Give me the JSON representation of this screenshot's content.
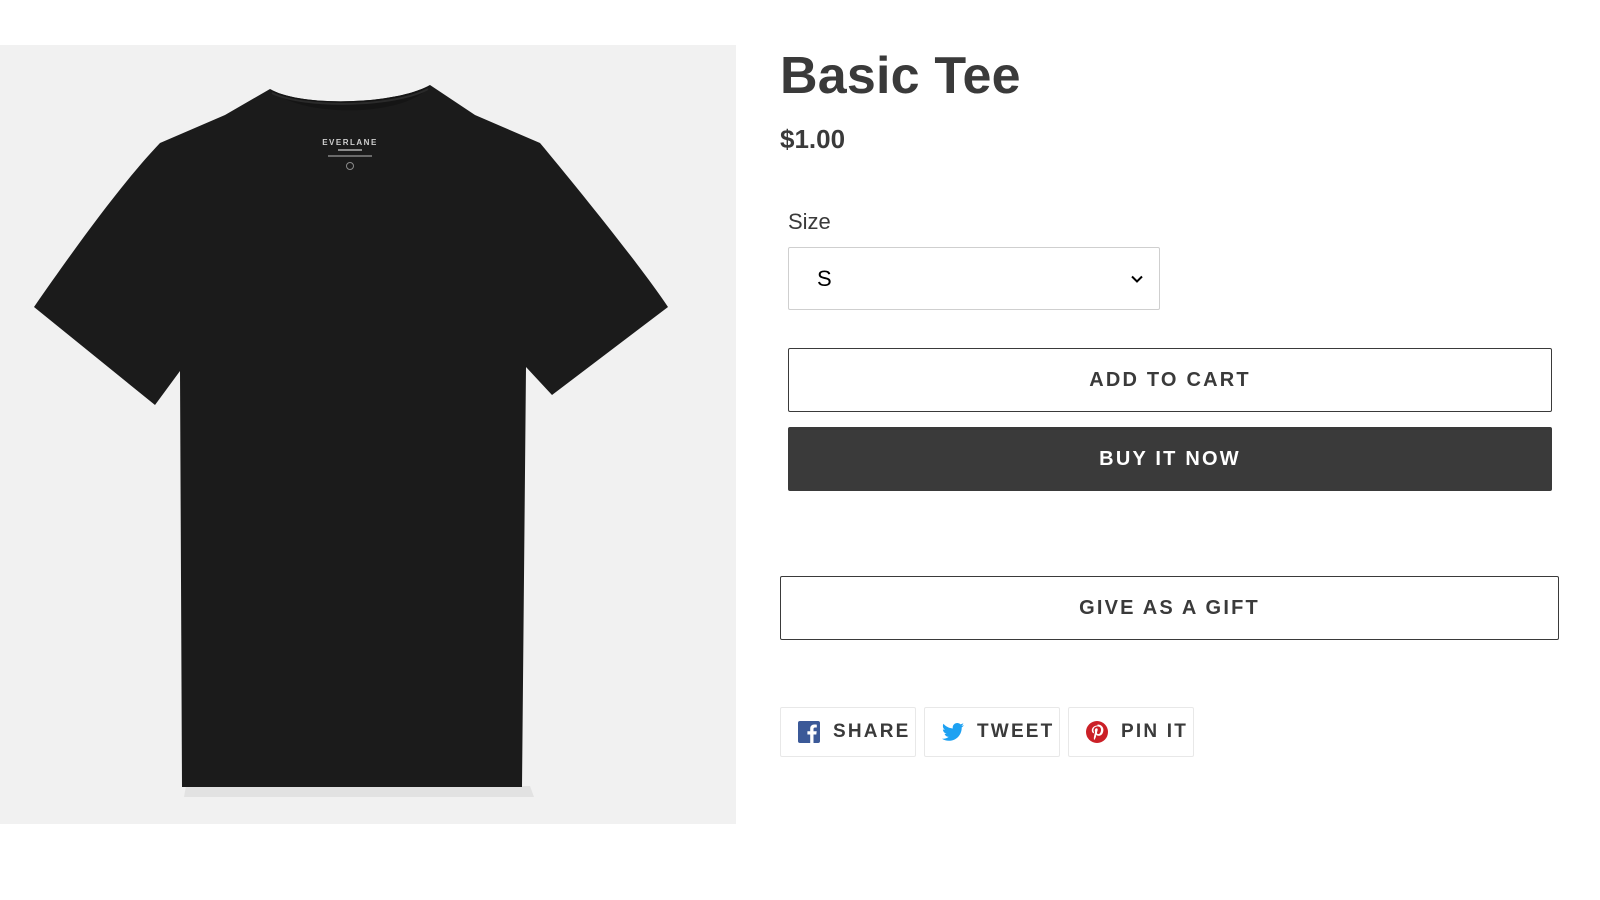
{
  "product": {
    "title": "Basic Tee",
    "price": "$1.00",
    "image": {
      "subject": "black crew-neck t-shirt",
      "brand_logo_text": "EVERLANE",
      "background_color": "#f1f1f1",
      "shirt_color": "#1b1b1b"
    }
  },
  "size": {
    "label": "Size",
    "selected": "S"
  },
  "buttons": {
    "add_to_cart": "ADD TO CART",
    "buy_now": "BUY IT NOW",
    "gift": "GIVE AS A GIFT"
  },
  "share": {
    "facebook": {
      "label": "SHARE",
      "icon": "facebook-icon",
      "color": "#3b5998"
    },
    "twitter": {
      "label": "TWEET",
      "icon": "twitter-icon",
      "color": "#1da1f2"
    },
    "pinterest": {
      "label": "PIN IT",
      "icon": "pinterest-icon",
      "color": "#cb2027"
    }
  },
  "colors": {
    "text": "#3a3a3a",
    "buy_button_bg": "#3a3a3a",
    "buy_button_text": "#ffffff",
    "border": "#3a3a3a"
  }
}
